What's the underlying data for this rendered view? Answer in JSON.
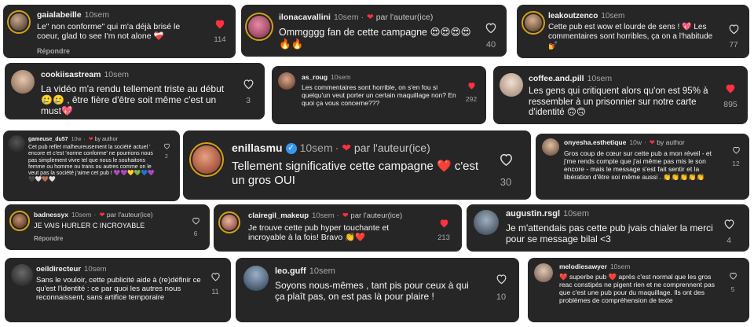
{
  "comments": [
    {
      "username": "gaialabeille",
      "time": "10sem",
      "text": "Le\" non conforme\" qui m'a déjà brisé le coeur, glad to see I'm not alone ❤️‍🩹",
      "likes": "114",
      "reply": "Répondre",
      "liked": true
    },
    {
      "username": "ilonacavallini",
      "time": "10sem",
      "author_tag": "par l'auteur(ice)",
      "text": "Ommgggg fan de cette campagne 😍😍😍😍🔥🔥",
      "likes": "40",
      "liked": false
    },
    {
      "username": "leakoutzenco",
      "time": "10sem",
      "text": "Cette pub est wow et lourde de sens ! 💖 Les commentaires sont horribles, ça on a l'habitude 💅",
      "likes": "77",
      "liked": false
    },
    {
      "username": "cookiisastream",
      "time": "10sem",
      "text": "La vidéo m'a rendu tellement triste au début 🥲🥲 , être fière d'être soit même c'est un must💖",
      "likes": "3",
      "liked": false
    },
    {
      "username": "as_roug",
      "time": "10sem",
      "text": "Les commentaires sont horrible, on s'en fou si quelqu'un veut porter un certain maquillage non? En quoi ça vous concerne???",
      "likes": "292",
      "liked": true
    },
    {
      "username": "coffee.and.pill",
      "time": "10sem",
      "text": "Les gens qui critiquent alors qu'on est 95% à ressembler à un prisonnier sur notre carte d'identité 🙃🙃",
      "likes": "895",
      "liked": true
    },
    {
      "username": "gameuse_du57",
      "time": "10w",
      "author_tag": "by author",
      "text": "Cet pub reflet malheureusement la société actuel ' encore et c'est 'norme conforme' ne pourrions nous pas simplement vivre tel que nous le souhaitons femme ou homme ou trans ou autres comme on le veut pas la société j'aime cet pub ! 💜💜💛💚💙💜🖤🤍🤎🤍",
      "likes": "2",
      "liked": false
    },
    {
      "username": "enillasmu",
      "time": "10sem",
      "author_tag": "par l'auteur(ice)",
      "text": "Tellement significative cette campagne ❤️ c'est un gros OUI",
      "likes": "30",
      "liked": false
    },
    {
      "username": "onyesha.esthetique",
      "time": "10w",
      "author_tag": "by author",
      "text": "Gros coup de cœur sur cette pub a mon réveil - et j'me rends compte que j'ai même pas mis le son encore - mais le message s'est fait sentir et la libération d'être soi même aussi . 👏👏👏👏👏",
      "likes": "12",
      "liked": false
    },
    {
      "username": "badnessyx",
      "time": "10sem",
      "author_tag": "par l'auteur(ice)",
      "text": "JE VAIS HURLER C INCROYABLE",
      "likes": "6",
      "reply": "Répondre",
      "liked": false
    },
    {
      "username": "clairegil_makeup",
      "time": "10sem",
      "author_tag": "par l'auteur(ice)",
      "text": "Je trouve cette pub hyper touchante et incroyable à la fois! Bravo 👏❤️",
      "likes": "213",
      "liked": true
    },
    {
      "username": "augustin.rsgl",
      "time": "10sem",
      "text": "Je m'attendais pas cette pub jvais chialer la merci pour se message bilal <3",
      "likes": "4",
      "liked": false
    },
    {
      "username": "oeildirecteur",
      "time": "10sem",
      "text": "Sans le vouloir, cette publicité aide à (re)définir ce qu'est l'identité : ce par quoi les autres nous reconnaissent, sans artifice  temporaire",
      "likes": "11",
      "liked": false
    },
    {
      "username": "leo.guff",
      "time": "10sem",
      "text": "Soyons nous-mêmes , tant pis pour ceux à qui ça plaît pas, on est pas là pour plaire !",
      "likes": "10",
      "liked": false
    },
    {
      "username": "melodiesawyer",
      "time": "10sem",
      "text": "❤️ superbe pub ❤️ après c'est normal que les gros reac constipés ne pigent rien et ne comprennent pas que c'est une pub pour du maquillage. Ils ont des problèmes de compréhension de texte",
      "likes": "5",
      "liked": false
    }
  ],
  "colors": {
    "card": "#262626",
    "like_red": "#ff3040",
    "muted": "#a8a8a8",
    "ring": "#d4a017",
    "verified": "#3897f0"
  }
}
